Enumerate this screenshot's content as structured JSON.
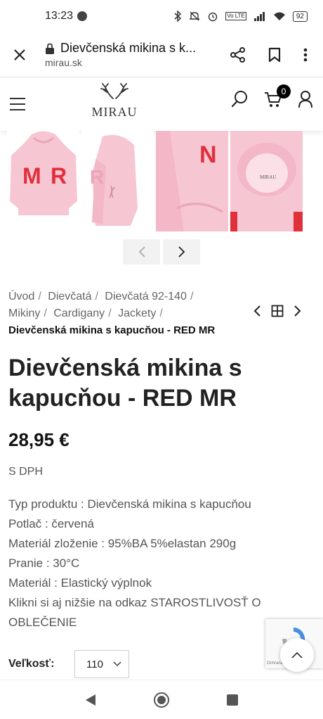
{
  "status_bar": {
    "time": "13:23",
    "battery": "92",
    "icons": [
      "bluetooth-icon",
      "mute-icon",
      "alarm-icon",
      "volte-icon",
      "signal-icon",
      "wifi-icon"
    ]
  },
  "browser": {
    "page_title": "Dievčenská mikina s k...",
    "domain": "mirau.sk",
    "icons": [
      "close-icon",
      "lock-icon",
      "share-icon",
      "bookmark-icon",
      "more-vert-icon"
    ]
  },
  "header": {
    "logo_text": "MIRAU",
    "cart_count": "0",
    "icons": [
      "hamburger-menu-icon",
      "antlers-logo-icon",
      "search-icon",
      "cart-icon",
      "user-icon"
    ]
  },
  "gallery": {
    "thumb_color": "#f7c6d3",
    "print_color": "#e0303b"
  },
  "breadcrumb": {
    "items": [
      "Úvod",
      "Dievčatá",
      "Dievčatá 92-140",
      "Mikiny",
      "Cardigany",
      "Jackety"
    ],
    "current": "Dievčenská mikina s kapucňou - RED MR"
  },
  "product": {
    "title": "Dievčenská mikina s kapucňou - RED MR",
    "price": "28,95 €",
    "tax_note": "S DPH",
    "description": [
      "Typ produktu : Dievčenská mikina s kapucňou",
      "Potlač : červená",
      "Materiál zloženie : 95%BA 5%elastan 290g",
      "Pranie : 30°C",
      "Materiál : Elastický výplnok",
      "Klikni si aj nižšie na odkaz STAROSTLIVOSŤ O OBLEČENIE"
    ],
    "size_label": "Veľkosť:",
    "size_value": "110"
  },
  "recaptcha": {
    "text": "Ochrana"
  }
}
